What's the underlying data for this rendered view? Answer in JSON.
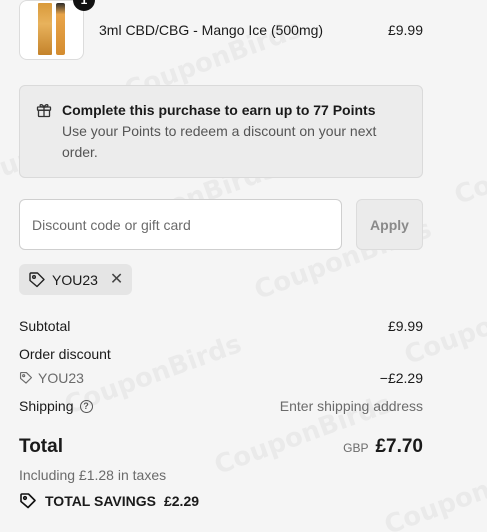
{
  "watermark": "CouponBirds",
  "cart_item": {
    "quantity": "1",
    "name": "3ml CBD/CBG - Mango Ice (500mg)",
    "price": "£9.99"
  },
  "points": {
    "title": "Complete this purchase to earn up to 77 Points",
    "subtitle": "Use your Points to redeem a discount on your next order."
  },
  "discount": {
    "placeholder": "Discount code or gift card",
    "apply_label": "Apply",
    "applied_code": "YOU23"
  },
  "summary": {
    "subtotal_label": "Subtotal",
    "subtotal_value": "£9.99",
    "order_discount_label": "Order discount",
    "discount_code": "YOU23",
    "discount_value": "−£2.29",
    "shipping_label": "Shipping",
    "shipping_value": "Enter shipping address",
    "total_label": "Total",
    "currency": "GBP",
    "total_value": "£7.70",
    "taxes_note": "Including £1.28 in taxes",
    "savings_label": "TOTAL SAVINGS",
    "savings_value": "£2.29"
  },
  "colors": {
    "background": "#f5f5f5",
    "text": "#1a1a1a",
    "muted": "#6b6b6b"
  },
  "icons": [
    "gift-icon",
    "tag-icon",
    "close-icon",
    "help-icon"
  ]
}
